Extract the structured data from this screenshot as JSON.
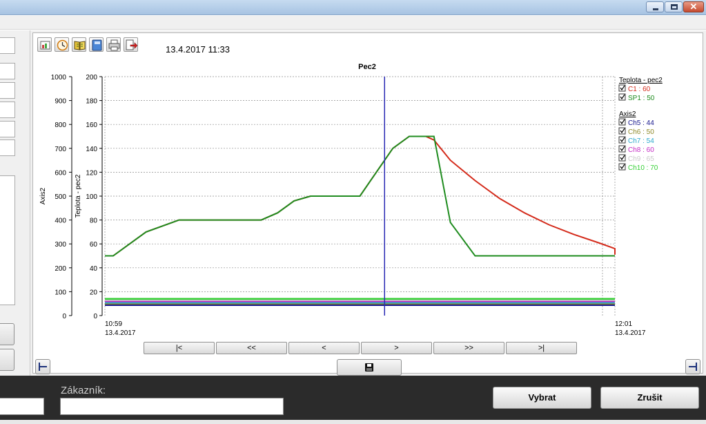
{
  "window": {
    "close_glyph": "✕"
  },
  "toolbar": {
    "icons": [
      "chart-settings-icon",
      "clock-icon",
      "book-icon",
      "notebook-icon",
      "printer-icon",
      "export-icon"
    ],
    "datetime": "13.4.2017 11:33"
  },
  "chart_data": {
    "type": "line",
    "title": "Pec2",
    "y_left_outer": {
      "label": "Axis2",
      "range": [
        0,
        1000
      ],
      "ticks": [
        0,
        100,
        200,
        300,
        400,
        500,
        600,
        700,
        800,
        900,
        1000
      ]
    },
    "y_left_inner": {
      "label": "Teplota - pec2",
      "range": [
        0,
        200
      ],
      "ticks": [
        0,
        20,
        40,
        60,
        80,
        100,
        120,
        140,
        160,
        180,
        200
      ]
    },
    "x_range_minutes": [
      0,
      62
    ],
    "x_start": {
      "time": "10:59",
      "date": "13.4.2017"
    },
    "x_end": {
      "time": "12:01",
      "date": "13.4.2017"
    },
    "cursor_minute": 34,
    "grid": true,
    "legend_position": "right",
    "series": [
      {
        "name": "C1",
        "legend": "C1 : 60",
        "axis": "Teplota - pec2",
        "color": "#d42a1a",
        "x": [
          0,
          1,
          5,
          9,
          19,
          21,
          23,
          25,
          31,
          33,
          35,
          37,
          39,
          40,
          42,
          45,
          48,
          51,
          54,
          57,
          60,
          63,
          66
        ],
        "y": [
          50,
          50,
          70,
          80,
          80,
          86,
          96,
          100,
          100,
          120,
          140,
          150,
          150,
          147,
          130,
          113,
          98,
          86,
          76,
          68,
          61,
          56,
          51
        ]
      },
      {
        "name": "SP1",
        "legend": "SP1 : 50",
        "axis": "Teplota - pec2",
        "color": "#1f8c1f",
        "x": [
          0,
          1,
          5,
          9,
          19,
          21,
          23,
          25,
          31,
          33,
          35,
          37,
          39,
          40,
          42,
          45,
          62
        ],
        "y": [
          50,
          50,
          70,
          80,
          80,
          86,
          96,
          100,
          100,
          120,
          140,
          150,
          150,
          150,
          78,
          50,
          50
        ]
      },
      {
        "name": "Ch5",
        "legend": "Ch5 : 44",
        "axis": "Axis2",
        "color": "#14148c",
        "x": [
          0,
          62
        ],
        "y": [
          44,
          44
        ]
      },
      {
        "name": "Ch6",
        "legend": "Ch6 : 50",
        "axis": "Axis2",
        "color": "#8f8a2a",
        "x": [
          0,
          62
        ],
        "y": [
          50,
          50
        ]
      },
      {
        "name": "Ch7",
        "legend": "Ch7 : 54",
        "axis": "Axis2",
        "color": "#2aa8cc",
        "x": [
          0,
          62
        ],
        "y": [
          54,
          54
        ]
      },
      {
        "name": "Ch8",
        "legend": "Ch8 : 60",
        "axis": "Axis2",
        "color": "#c42bc4",
        "x": [
          0,
          62
        ],
        "y": [
          60,
          60
        ]
      },
      {
        "name": "Ch9",
        "legend": "Ch9 : 65",
        "axis": "Axis2",
        "color": "#c9c9c9",
        "x": [
          0,
          62
        ],
        "y": [
          65,
          65
        ]
      },
      {
        "name": "Ch10",
        "legend": "Ch10 : 70",
        "axis": "Axis2",
        "color": "#35d035",
        "x": [
          0,
          62
        ],
        "y": [
          70,
          70
        ]
      }
    ],
    "legend_groups": [
      {
        "title": "Teplota - pec2",
        "items": [
          "C1 : 60",
          "SP1 : 50"
        ]
      },
      {
        "title": "Axis2",
        "items": [
          "Ch5 : 44",
          "Ch6 : 50",
          "Ch7 : 54",
          "Ch8 : 60",
          "Ch9 : 65",
          "Ch10 : 70"
        ]
      }
    ]
  },
  "navigation": {
    "first": "|<",
    "prev_page": "<<",
    "prev": "<",
    "next": ">",
    "next_page": ">>",
    "last": ">|"
  },
  "form": {
    "customer_label": "Zákazník:",
    "customer_value": "",
    "select_button": "Vybrat",
    "cancel_button": "Zrušit"
  },
  "colors": {
    "cursor": "#2b2bb5",
    "grid": "#8c8c8c"
  }
}
